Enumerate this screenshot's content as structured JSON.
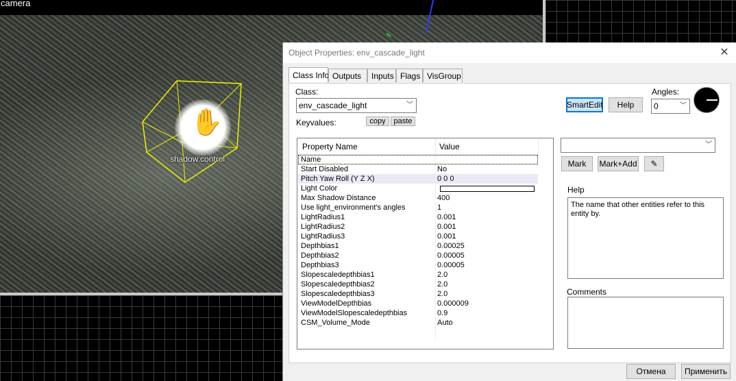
{
  "viewport": {
    "camera_label": "camera",
    "entity_label": "shadow.control"
  },
  "dialog": {
    "title": "Object Properties: env_cascade_light",
    "close_glyph": "✕",
    "tabs": [
      "Class Info",
      "Outputs",
      "Inputs",
      "Flags",
      "VisGroup"
    ],
    "active_tab": "Class Info",
    "class_label": "Class:",
    "class_value": "env_cascade_light",
    "keyvalues_label": "Keyvalues:",
    "copy_label": "copy",
    "paste_label": "paste",
    "smartedit_label": "SmartEdit",
    "help_button_label": "Help",
    "angles_label": "Angles:",
    "angles_value": "0",
    "property_header": "Property Name",
    "value_header": "Value",
    "properties": [
      {
        "name": "Name",
        "value": ""
      },
      {
        "name": "Start Disabled",
        "value": "No"
      },
      {
        "name": "Pitch Yaw Roll (Y Z X)",
        "value": "0 0 0"
      },
      {
        "name": "Light Color",
        "value": ""
      },
      {
        "name": "Max Shadow Distance",
        "value": "400"
      },
      {
        "name": "Use light_environment's angles",
        "value": "1"
      },
      {
        "name": "LightRadius1",
        "value": "0.001"
      },
      {
        "name": "LightRadius2",
        "value": "0.001"
      },
      {
        "name": "LightRadius3",
        "value": "0.001"
      },
      {
        "name": "Depthbias1",
        "value": "0.00025"
      },
      {
        "name": "Depthbias2",
        "value": "0.00005"
      },
      {
        "name": "Depthbias3",
        "value": "0.00005"
      },
      {
        "name": "Slopescaledepthbias1",
        "value": "2.0"
      },
      {
        "name": "Slopescaledepthbias2",
        "value": "2.0"
      },
      {
        "name": "Slopescaledepthbias3",
        "value": "2.0"
      },
      {
        "name": "ViewModelDepthbias",
        "value": "0.000009"
      },
      {
        "name": "ViewModelSlopescaledepthbias",
        "value": "0.9"
      },
      {
        "name": "CSM_Volume_Mode",
        "value": "Auto"
      }
    ],
    "value_select": "",
    "mark_label": "Mark",
    "mark_add_label": "Mark+Add",
    "help_label": "Help",
    "help_text": "The name that other entities refer to this entity by.",
    "comments_label": "Comments",
    "comments_text": "",
    "cancel_label": "Отмена",
    "apply_label": "Применить"
  },
  "colors": {
    "selection_box": "#f0f000",
    "focus_blue": "#0078d7"
  }
}
